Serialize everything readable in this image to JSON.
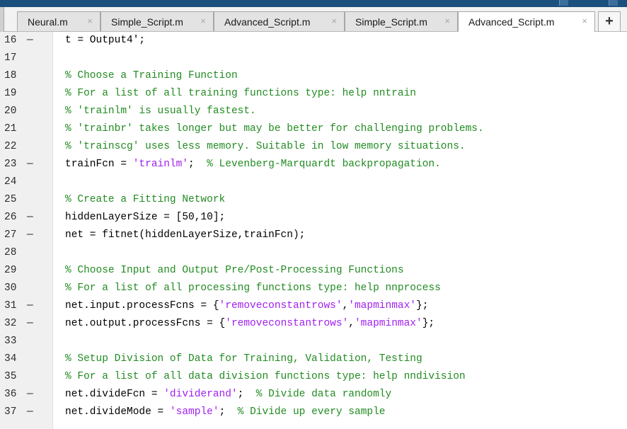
{
  "tabs": [
    {
      "label": "Neural.m",
      "active": false
    },
    {
      "label": "Simple_Script.m",
      "active": false
    },
    {
      "label": "Advanced_Script.m",
      "active": false
    },
    {
      "label": "Simple_Script.m",
      "active": false
    },
    {
      "label": "Advanced_Script.m",
      "active": true
    }
  ],
  "tab_close_glyph": "×",
  "add_tab_glyph": "+",
  "colors": {
    "comment": "#228b22",
    "string": "#a020f0",
    "code": "#000000"
  },
  "lines": [
    {
      "num": "16",
      "mark": "—",
      "tokens": [
        {
          "t": "t = Output4';",
          "c": ""
        }
      ]
    },
    {
      "num": "17",
      "mark": "",
      "tokens": []
    },
    {
      "num": "18",
      "mark": "",
      "tokens": [
        {
          "t": "% Choose a Training Function",
          "c": "cm"
        }
      ]
    },
    {
      "num": "19",
      "mark": "",
      "tokens": [
        {
          "t": "% For a list of all training functions type: help nntrain",
          "c": "cm"
        }
      ]
    },
    {
      "num": "20",
      "mark": "",
      "tokens": [
        {
          "t": "% 'trainlm' is usually fastest.",
          "c": "cm"
        }
      ]
    },
    {
      "num": "21",
      "mark": "",
      "tokens": [
        {
          "t": "% 'trainbr' takes longer but may be better for challenging problems.",
          "c": "cm"
        }
      ]
    },
    {
      "num": "22",
      "mark": "",
      "tokens": [
        {
          "t": "% 'trainscg' uses less memory. Suitable in low memory situations.",
          "c": "cm"
        }
      ]
    },
    {
      "num": "23",
      "mark": "—",
      "tokens": [
        {
          "t": "trainFcn = ",
          "c": ""
        },
        {
          "t": "'trainlm'",
          "c": "st"
        },
        {
          "t": ";  ",
          "c": ""
        },
        {
          "t": "% Levenberg-Marquardt backpropagation.",
          "c": "cm"
        }
      ]
    },
    {
      "num": "24",
      "mark": "",
      "tokens": []
    },
    {
      "num": "25",
      "mark": "",
      "tokens": [
        {
          "t": "% Create a Fitting Network",
          "c": "cm"
        }
      ]
    },
    {
      "num": "26",
      "mark": "—",
      "tokens": [
        {
          "t": "hiddenLayerSize = [50,10];",
          "c": ""
        }
      ]
    },
    {
      "num": "27",
      "mark": "—",
      "tokens": [
        {
          "t": "net = fitnet(hiddenLayerSize,trainFcn);",
          "c": ""
        }
      ]
    },
    {
      "num": "28",
      "mark": "",
      "tokens": []
    },
    {
      "num": "29",
      "mark": "",
      "tokens": [
        {
          "t": "% Choose Input and Output Pre/Post-Processing Functions",
          "c": "cm"
        }
      ]
    },
    {
      "num": "30",
      "mark": "",
      "tokens": [
        {
          "t": "% For a list of all processing functions type: help nnprocess",
          "c": "cm"
        }
      ]
    },
    {
      "num": "31",
      "mark": "—",
      "tokens": [
        {
          "t": "net.input.processFcns = {",
          "c": ""
        },
        {
          "t": "'removeconstantrows'",
          "c": "st"
        },
        {
          "t": ",",
          "c": ""
        },
        {
          "t": "'mapminmax'",
          "c": "st"
        },
        {
          "t": "};",
          "c": ""
        }
      ]
    },
    {
      "num": "32",
      "mark": "—",
      "tokens": [
        {
          "t": "net.output.processFcns = {",
          "c": ""
        },
        {
          "t": "'removeconstantrows'",
          "c": "st"
        },
        {
          "t": ",",
          "c": ""
        },
        {
          "t": "'mapminmax'",
          "c": "st"
        },
        {
          "t": "};",
          "c": ""
        }
      ]
    },
    {
      "num": "33",
      "mark": "",
      "tokens": []
    },
    {
      "num": "34",
      "mark": "",
      "tokens": [
        {
          "t": "% Setup Division of Data for Training, Validation, Testing",
          "c": "cm"
        }
      ]
    },
    {
      "num": "35",
      "mark": "",
      "tokens": [
        {
          "t": "% For a list of all data division functions type: help nndivision",
          "c": "cm"
        }
      ]
    },
    {
      "num": "36",
      "mark": "—",
      "tokens": [
        {
          "t": "net.divideFcn = ",
          "c": ""
        },
        {
          "t": "'dividerand'",
          "c": "st"
        },
        {
          "t": ";  ",
          "c": ""
        },
        {
          "t": "% Divide data randomly",
          "c": "cm"
        }
      ]
    },
    {
      "num": "37",
      "mark": "—",
      "tokens": [
        {
          "t": "net.divideMode = ",
          "c": ""
        },
        {
          "t": "'sample'",
          "c": "st"
        },
        {
          "t": ";  ",
          "c": ""
        },
        {
          "t": "% Divide up every sample",
          "c": "cm"
        }
      ]
    }
  ]
}
